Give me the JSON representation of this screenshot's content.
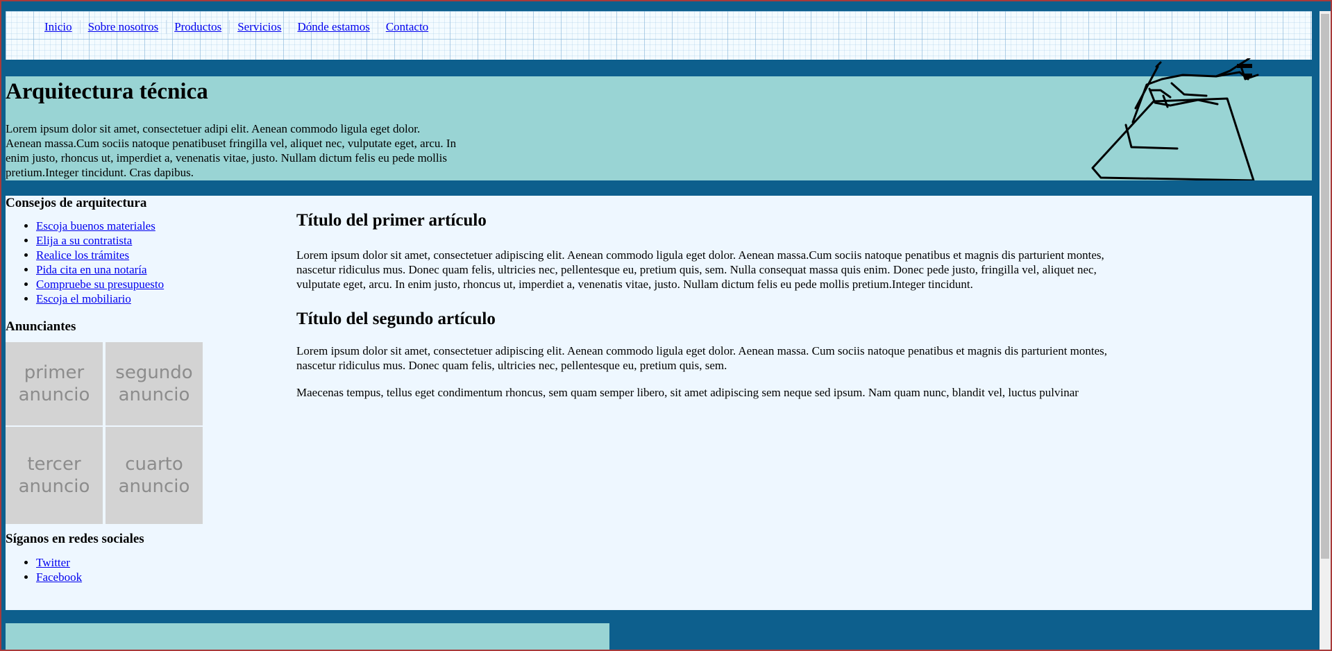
{
  "nav": {
    "items": [
      {
        "label": "Inicio"
      },
      {
        "label": "Sobre nosotros"
      },
      {
        "label": "Productos"
      },
      {
        "label": "Servicios"
      },
      {
        "label": "Dónde estamos"
      },
      {
        "label": "Contacto"
      }
    ]
  },
  "hero": {
    "title": "Arquitectura técnica",
    "text": "Lorem ipsum dolor sit amet, consectetuer adipi elit. Aenean commodo ligula eget dolor. Aenean massa.Cum sociis natoque penatibuset fringilla vel, aliquet nec, vulputate eget, arcu. In enim justo, rhoncus ut, imperdiet a, venenatis vitae, justo. Nullam dictum felis eu pede mollis pretium.Integer tincidunt. Cras dapibus.",
    "image_icon": "hand-drawing-illustration"
  },
  "sidebar": {
    "tips_title": "Consejos de arquitectura",
    "tips": [
      {
        "label": "Escoja buenos materiales"
      },
      {
        "label": "Elija a su contratista"
      },
      {
        "label": "Realice los trámites"
      },
      {
        "label": "Pida cita en una notaría"
      },
      {
        "label": "Compruebe su presupuesto"
      },
      {
        "label": "Escoja el mobiliario"
      }
    ],
    "ads_title": "Anunciantes",
    "ads": [
      {
        "label": "primer anuncio"
      },
      {
        "label": "segundo anuncio"
      },
      {
        "label": "tercer anuncio"
      },
      {
        "label": "cuarto anuncio"
      }
    ],
    "social_title": "Síganos en redes sociales",
    "social": [
      {
        "label": "Twitter"
      },
      {
        "label": "Facebook"
      }
    ]
  },
  "articles": [
    {
      "title": "Título del primer artículo",
      "paragraphs": [
        "Lorem ipsum dolor sit amet, consectetuer adipiscing elit. Aenean commodo ligula eget dolor. Aenean massa.Cum sociis natoque penatibus et magnis dis parturient montes, nascetur ridiculus mus. Donec quam felis, ultricies nec, pellentesque eu, pretium quis, sem. Nulla consequat massa quis enim. Donec pede justo, fringilla vel, aliquet nec, vulputate eget, arcu. In enim justo, rhoncus ut, imperdiet a, venenatis vitae, justo. Nullam dictum felis eu pede mollis pretium.Integer tincidunt."
      ]
    },
    {
      "title": "Título del segundo artículo",
      "paragraphs": [
        "Lorem ipsum dolor sit amet, consectetuer adipiscing elit. Aenean commodo ligula eget dolor. Aenean massa. Cum sociis natoque penatibus et magnis dis parturient montes, nascetur ridiculus mus. Donec quam felis, ultricies nec, pellentesque eu, pretium quis, sem.",
        "Maecenas tempus, tellus eget condimentum rhoncus, sem quam semper libero, sit amet adipiscing sem neque sed ipsum. Nam quam nunc, blandit vel, luctus pulvinar"
      ]
    }
  ],
  "colors": {
    "page_background": "#0d5f8d",
    "hero_background": "#99d4d4",
    "main_background": "#eef7ff",
    "link": "#0000ee",
    "ad_background": "#d3d3d3"
  }
}
